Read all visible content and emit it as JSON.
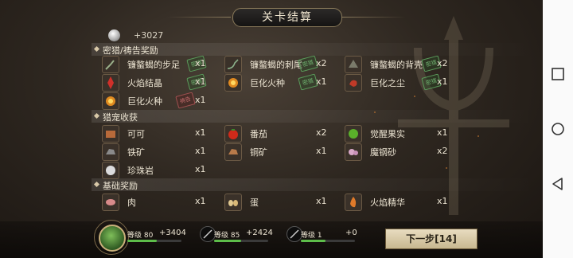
{
  "title": "关卡结算",
  "coin": {
    "value": "+3027"
  },
  "sections": {
    "hunt": "密猎/祷告奖励",
    "pet": "猎宠收获",
    "base": "基础奖励"
  },
  "hunt_items": [
    {
      "name": "镰螯蝎的步足",
      "qty": "x1",
      "stamp": "密猎",
      "icon": "scorpion-leg-icon"
    },
    {
      "name": "镰螯蝎的刺尾",
      "qty": "x2",
      "stamp": "密猎",
      "icon": "scorpion-tail-icon"
    },
    {
      "name": "镰螯蝎的背壳",
      "qty": "x2",
      "stamp": "密猎",
      "icon": "scorpion-shell-icon"
    },
    {
      "name": "火焰结晶",
      "qty": "x1",
      "stamp": "密猎",
      "icon": "fire-crystal-icon"
    },
    {
      "name": "巨化火种",
      "qty": "x1",
      "stamp": "密猎",
      "icon": "giant-tinder-icon"
    },
    {
      "name": "巨化之尘",
      "qty": "x1",
      "stamp": "密猎",
      "icon": "giant-dust-icon"
    },
    {
      "name": "巨化火种",
      "qty": "x1",
      "stamp": "祷告",
      "icon": "giant-tinder-icon"
    }
  ],
  "pet_items": [
    {
      "name": "可可",
      "qty": "x1",
      "icon": "cocoa-icon"
    },
    {
      "name": "番茄",
      "qty": "x2",
      "icon": "tomato-icon"
    },
    {
      "name": "觉醒果实",
      "qty": "x1",
      "icon": "awakening-fruit-icon"
    },
    {
      "name": "铁矿",
      "qty": "x1",
      "icon": "iron-ore-icon"
    },
    {
      "name": "铜矿",
      "qty": "x1",
      "icon": "copper-ore-icon"
    },
    {
      "name": "魔钢砂",
      "qty": "x2",
      "icon": "magic-steel-sand-icon"
    },
    {
      "name": "珍珠岩",
      "qty": "x1",
      "icon": "perlite-icon"
    }
  ],
  "base_items": [
    {
      "name": "肉",
      "qty": "x1",
      "icon": "meat-icon"
    },
    {
      "name": "蛋",
      "qty": "x1",
      "icon": "egg-icon"
    },
    {
      "name": "火焰精华",
      "qty": "x1",
      "icon": "fire-essence-icon"
    }
  ],
  "stats": [
    {
      "level_label": "等级",
      "level": "80",
      "xp": "+3404",
      "progress": 0.55
    },
    {
      "level_label": "等级",
      "level": "85",
      "xp": "+2424",
      "progress": 0.5
    },
    {
      "level_label": "等级",
      "level": "1",
      "xp": "+0",
      "progress": 0.45
    }
  ],
  "next_button": "下一步[14]",
  "colors": {
    "accent": "#5dbd4a",
    "stamp_green": "#6fb06f",
    "stamp_red": "#c06a6a"
  }
}
